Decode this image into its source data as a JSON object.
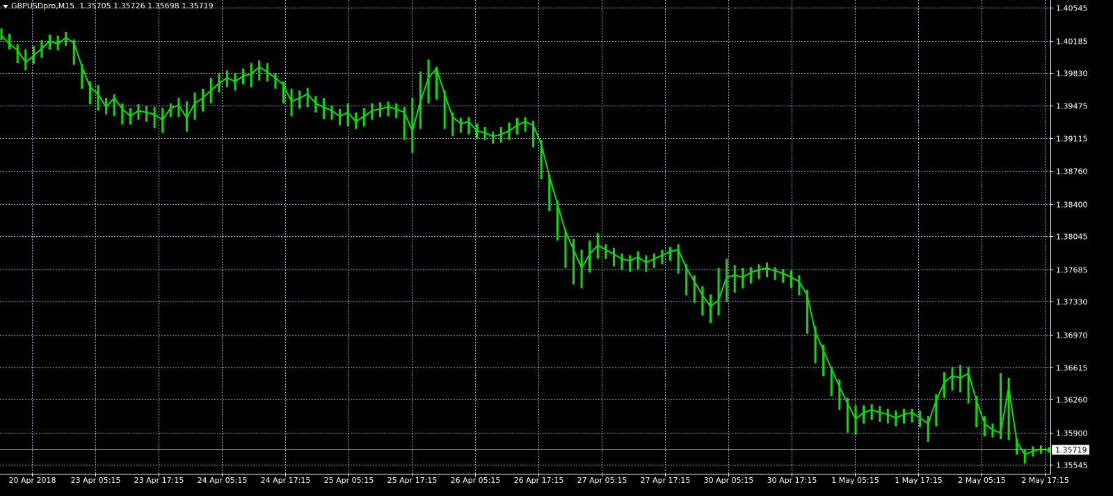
{
  "header": {
    "symbol": "GBPUSDpro,M15",
    "ohlc": "1.35705 1.35726 1.35698 1.35719"
  },
  "colors": {
    "background": "#000000",
    "grid": "#a8b0c8",
    "series": "#00e400",
    "axis": "#ffffff",
    "price_line": "#b0b8c8"
  },
  "chart_data": {
    "type": "line",
    "title": "",
    "xlabel": "",
    "ylabel": "",
    "grid": true,
    "x_tick_labels": [
      "20 Apr 2018",
      "23 Apr 05:15",
      "23 Apr 17:15",
      "24 Apr 05:15",
      "24 Apr 17:15",
      "25 Apr 05:15",
      "25 Apr 17:15",
      "26 Apr 05:15",
      "26 Apr 17:15",
      "27 Apr 05:15",
      "27 Apr 17:15",
      "30 Apr 05:15",
      "30 Apr 17:15",
      "1 May 05:15",
      "1 May 17:15",
      "2 May 05:15",
      "2 May 17:15"
    ],
    "y_tick_labels": [
      "1.40545",
      "1.40185",
      "1.39830",
      "1.39475",
      "1.39115",
      "1.38760",
      "1.38400",
      "1.38045",
      "1.37685",
      "1.37330",
      "1.36970",
      "1.36615",
      "1.36260",
      "1.35900",
      "1.35545"
    ],
    "ylim": [
      1.3545,
      1.4063
    ],
    "current_price_label": "1.35719",
    "current_price": 1.35719,
    "series": [
      {
        "values": [
          1.4024,
          1.4015,
          1.4008,
          1.3995,
          1.4002,
          1.401,
          1.4018,
          1.4015,
          1.4022,
          1.4016,
          1.399,
          1.3968,
          1.396,
          1.3946,
          1.3956,
          1.3944,
          1.3936,
          1.3942,
          1.394,
          1.3938,
          1.3932,
          1.3945,
          1.3948,
          1.3934,
          1.395,
          1.3956,
          1.3964,
          1.3972,
          1.3978,
          1.3974,
          1.398,
          1.3982,
          1.399,
          1.3984,
          1.3978,
          1.397,
          1.3952,
          1.3956,
          1.396,
          1.395,
          1.3946,
          1.3942,
          1.3936,
          1.394,
          1.393,
          1.3936,
          1.3942,
          1.3944,
          1.3946,
          1.3944,
          1.394,
          1.392,
          1.3952,
          1.3978,
          1.3988,
          1.396,
          1.3935,
          1.3928,
          1.393,
          1.392,
          1.3918,
          1.3914,
          1.3916,
          1.392,
          1.3926,
          1.393,
          1.3926,
          1.3905,
          1.387,
          1.384,
          1.381,
          1.379,
          1.377,
          1.3785,
          1.3795,
          1.379,
          1.3785,
          1.378,
          1.3778,
          1.3782,
          1.3776,
          1.378,
          1.3784,
          1.3788,
          1.379,
          1.377,
          1.3755,
          1.374,
          1.3728,
          1.3735,
          1.376,
          1.3762,
          1.376,
          1.3765,
          1.3768,
          1.377,
          1.3767,
          1.3764,
          1.376,
          1.3755,
          1.374,
          1.37,
          1.368,
          1.366,
          1.364,
          1.3622,
          1.3605,
          1.3612,
          1.3615,
          1.3612,
          1.361,
          1.3606,
          1.361,
          1.3612,
          1.3606,
          1.36,
          1.3625,
          1.3645,
          1.3652,
          1.365,
          1.3655,
          1.3625,
          1.36,
          1.3593,
          1.359,
          1.364,
          1.358,
          1.3566,
          1.357,
          1.3572,
          1.3571
        ],
        "lows": [
          1.4019,
          1.4009,
          1.3994,
          1.3986,
          1.3993,
          1.4,
          1.4009,
          1.4008,
          1.4013,
          1.3992,
          1.3966,
          1.3949,
          1.3942,
          1.3938,
          1.3936,
          1.3927,
          1.3927,
          1.3932,
          1.393,
          1.3923,
          1.3918,
          1.3935,
          1.3935,
          1.3919,
          1.3932,
          1.3941,
          1.395,
          1.3962,
          1.3968,
          1.3964,
          1.3971,
          1.3968,
          1.3975,
          1.3974,
          1.3966,
          1.395,
          1.3936,
          1.3944,
          1.3946,
          1.394,
          1.3933,
          1.3932,
          1.3926,
          1.3925,
          1.3922,
          1.3925,
          1.3932,
          1.3935,
          1.3936,
          1.3934,
          1.391,
          1.3896,
          1.3922,
          1.395,
          1.3954,
          1.3922,
          1.3914,
          1.3918,
          1.3916,
          1.3911,
          1.391,
          1.3906,
          1.3907,
          1.391,
          1.3916,
          1.3919,
          1.3902,
          1.3867,
          1.3832,
          1.38,
          1.377,
          1.3752,
          1.3748,
          1.3765,
          1.378,
          1.378,
          1.3772,
          1.3768,
          1.3766,
          1.3769,
          1.3766,
          1.377,
          1.3774,
          1.3778,
          1.3764,
          1.374,
          1.3732,
          1.3718,
          1.371,
          1.3718,
          1.3733,
          1.3743,
          1.3748,
          1.3753,
          1.3758,
          1.376,
          1.3757,
          1.3754,
          1.3748,
          1.374,
          1.3698,
          1.3666,
          1.3652,
          1.363,
          1.3615,
          1.359,
          1.3588,
          1.36,
          1.3604,
          1.3602,
          1.36,
          1.3597,
          1.36,
          1.3601,
          1.3596,
          1.358,
          1.3597,
          1.3628,
          1.3636,
          1.3634,
          1.3622,
          1.3596,
          1.3586,
          1.3585,
          1.3583,
          1.3582,
          1.3566,
          1.3556,
          1.3564,
          1.3567,
          1.3568
        ],
        "highs": [
          1.4032,
          1.4026,
          1.4015,
          1.4009,
          1.4013,
          1.4019,
          1.4025,
          1.4024,
          1.4028,
          1.402,
          1.3993,
          1.3974,
          1.397,
          1.3956,
          1.396,
          1.395,
          1.3945,
          1.3949,
          1.3947,
          1.3946,
          1.3945,
          1.395,
          1.3956,
          1.3952,
          1.3962,
          1.3966,
          1.3978,
          1.3983,
          1.3986,
          1.3983,
          1.3988,
          1.3994,
          1.3997,
          1.3994,
          1.3983,
          1.3974,
          1.3966,
          1.3964,
          1.3967,
          1.3958,
          1.3956,
          1.3948,
          1.3944,
          1.395,
          1.394,
          1.3945,
          1.395,
          1.3951,
          1.3952,
          1.395,
          1.3946,
          1.3956,
          1.3985,
          1.3998,
          1.399,
          1.3964,
          1.394,
          1.3934,
          1.3935,
          1.3928,
          1.3924,
          1.3919,
          1.3924,
          1.3929,
          1.3934,
          1.3935,
          1.3931,
          1.391,
          1.3872,
          1.3844,
          1.3812,
          1.3802,
          1.379,
          1.38,
          1.3808,
          1.3796,
          1.3792,
          1.3786,
          1.3784,
          1.3788,
          1.3784,
          1.3786,
          1.379,
          1.3793,
          1.3796,
          1.3774,
          1.3762,
          1.375,
          1.3741,
          1.377,
          1.378,
          1.3773,
          1.377,
          1.3771,
          1.3774,
          1.3776,
          1.3771,
          1.3769,
          1.3767,
          1.3762,
          1.3746,
          1.3706,
          1.3686,
          1.3662,
          1.3648,
          1.3628,
          1.362,
          1.362,
          1.3621,
          1.3619,
          1.3616,
          1.3614,
          1.3616,
          1.3616,
          1.3614,
          1.3608,
          1.3632,
          1.3656,
          1.3662,
          1.3664,
          1.3662,
          1.363,
          1.3608,
          1.36,
          1.3655,
          1.365,
          1.3584,
          1.3572,
          1.3575,
          1.3576,
          1.3574
        ]
      }
    ]
  }
}
